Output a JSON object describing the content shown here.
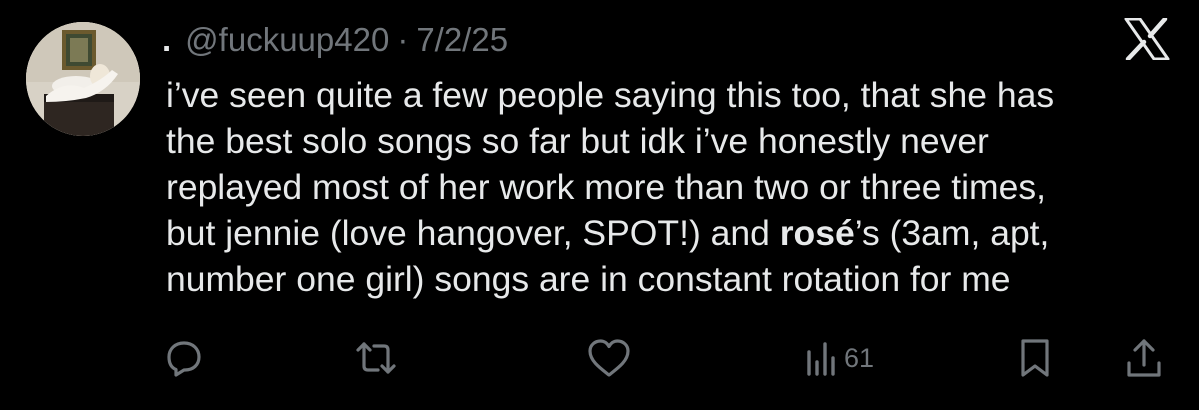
{
  "author": {
    "display_name": ".",
    "handle": "@fuckuup420",
    "date": "7/2/25",
    "separator": "·"
  },
  "tweet": {
    "lines": [
      {
        "text": "i’ve seen quite a few people saying this too, that she has"
      },
      {
        "text": "the best solo songs so far but idk i’ve honestly never"
      },
      {
        "text": "replayed most of her work more than two or three times,"
      },
      {
        "pre": "but jennie (love hangover, SPOT!) and ",
        "bold": "rosé",
        "post": "’s (3am, apt,"
      },
      {
        "text": "number one girl) songs are in constant rotation for me"
      }
    ]
  },
  "actions": {
    "reply_icon": "reply-icon",
    "retweet_icon": "retweet-icon",
    "like_icon": "heart-icon",
    "views_icon": "views-icon",
    "views_count": "61",
    "bookmark_icon": "bookmark-icon",
    "share_icon": "share-icon"
  },
  "brand": {
    "logo": "x-logo-icon"
  },
  "colors": {
    "background": "#000000",
    "text": "#e7e9ea",
    "muted": "#71767b"
  }
}
